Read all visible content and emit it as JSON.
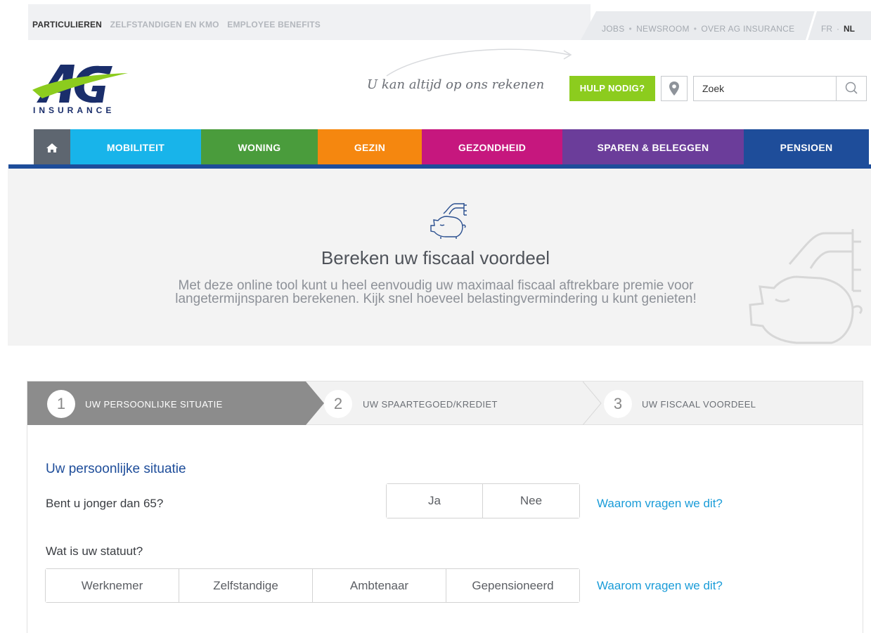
{
  "topbar": {
    "segments": [
      {
        "label": "PARTICULIEREN",
        "active": true
      },
      {
        "label": "ZELFSTANDIGEN EN KMO",
        "active": false
      },
      {
        "label": "EMPLOYEE BENEFITS",
        "active": false
      }
    ],
    "corporate_links": [
      "JOBS",
      "NEWSROOM",
      "OVER AG INSURANCE"
    ],
    "languages": {
      "fr": "FR",
      "nl": "NL",
      "active": "NL"
    }
  },
  "header": {
    "logo_text": "INSURANCE",
    "slogan": "U kan altijd op ons rekenen",
    "help_label": "HULP NODIG?",
    "search_placeholder": "Zoek",
    "colors": {
      "help": "#8ccc1e",
      "brand_blue": "#1e4d9a",
      "brand_green": "#8ccc1e"
    }
  },
  "nav": {
    "items": [
      {
        "label": "MOBILITEIT",
        "color": "#18b4ea"
      },
      {
        "label": "WONING",
        "color": "#4a9c3c"
      },
      {
        "label": "GEZIN",
        "color": "#f5870f"
      },
      {
        "label": "GEZONDHEID",
        "color": "#c6177e"
      },
      {
        "label": "SPAREN & BELEGGEN",
        "color": "#6b3d9a"
      },
      {
        "label": "PENSIOEN",
        "color": "#1e4d9a"
      }
    ],
    "home_icon": "home-icon"
  },
  "banner": {
    "title": "Bereken uw fiscaal voordeel",
    "line1": "Met deze online tool kunt u heel eenvoudig uw maximaal fiscaal aftrekbare premie voor",
    "line2": "langetermijnsparen berekenen. Kijk snel hoeveel belastingvermindering u kunt genieten!",
    "icon": "piggy-bank-icon"
  },
  "steps": [
    {
      "number": "1",
      "label": "UW PERSOONLIJKE SITUATIE",
      "active": true
    },
    {
      "number": "2",
      "label": "UW SPAARTEGOED/KREDIET",
      "active": false
    },
    {
      "number": "3",
      "label": "UW FISCAAL VOORDEEL",
      "active": false
    }
  ],
  "form": {
    "section_title": "Uw persoonlijke situatie",
    "q1": {
      "label": "Bent u jonger dan 65?",
      "options": [
        "Ja",
        "Nee"
      ],
      "why": "Waarom vragen we dit?"
    },
    "q2": {
      "label": "Wat is uw statuut?",
      "options": [
        "Werknemer",
        "Zelfstandige",
        "Ambtenaar",
        "Gepensioneerd"
      ],
      "why": "Waarom vragen we dit?"
    }
  }
}
